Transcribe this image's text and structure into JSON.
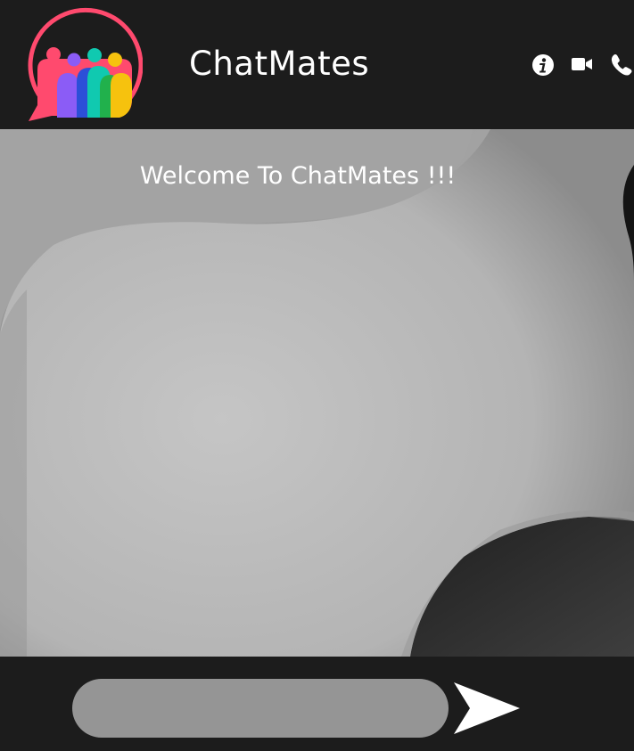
{
  "header": {
    "app_title": "ChatMates",
    "icons": [
      "info-icon",
      "video-icon",
      "phone-icon"
    ],
    "colors": {
      "background": "#1c1c1c",
      "logo_ring": "#ff4a6e",
      "person_purple": "#8b5cf6",
      "person_teal": "#10c9b0",
      "person_yellow": "#f6c20e",
      "person_blue": "#2c4fd8",
      "person_green": "#21b14c"
    }
  },
  "chat": {
    "welcome_message": "Welcome To ChatMates !!!"
  },
  "composer": {
    "input_value": "",
    "input_placeholder": "",
    "send_icon": "send-arrow-icon"
  }
}
